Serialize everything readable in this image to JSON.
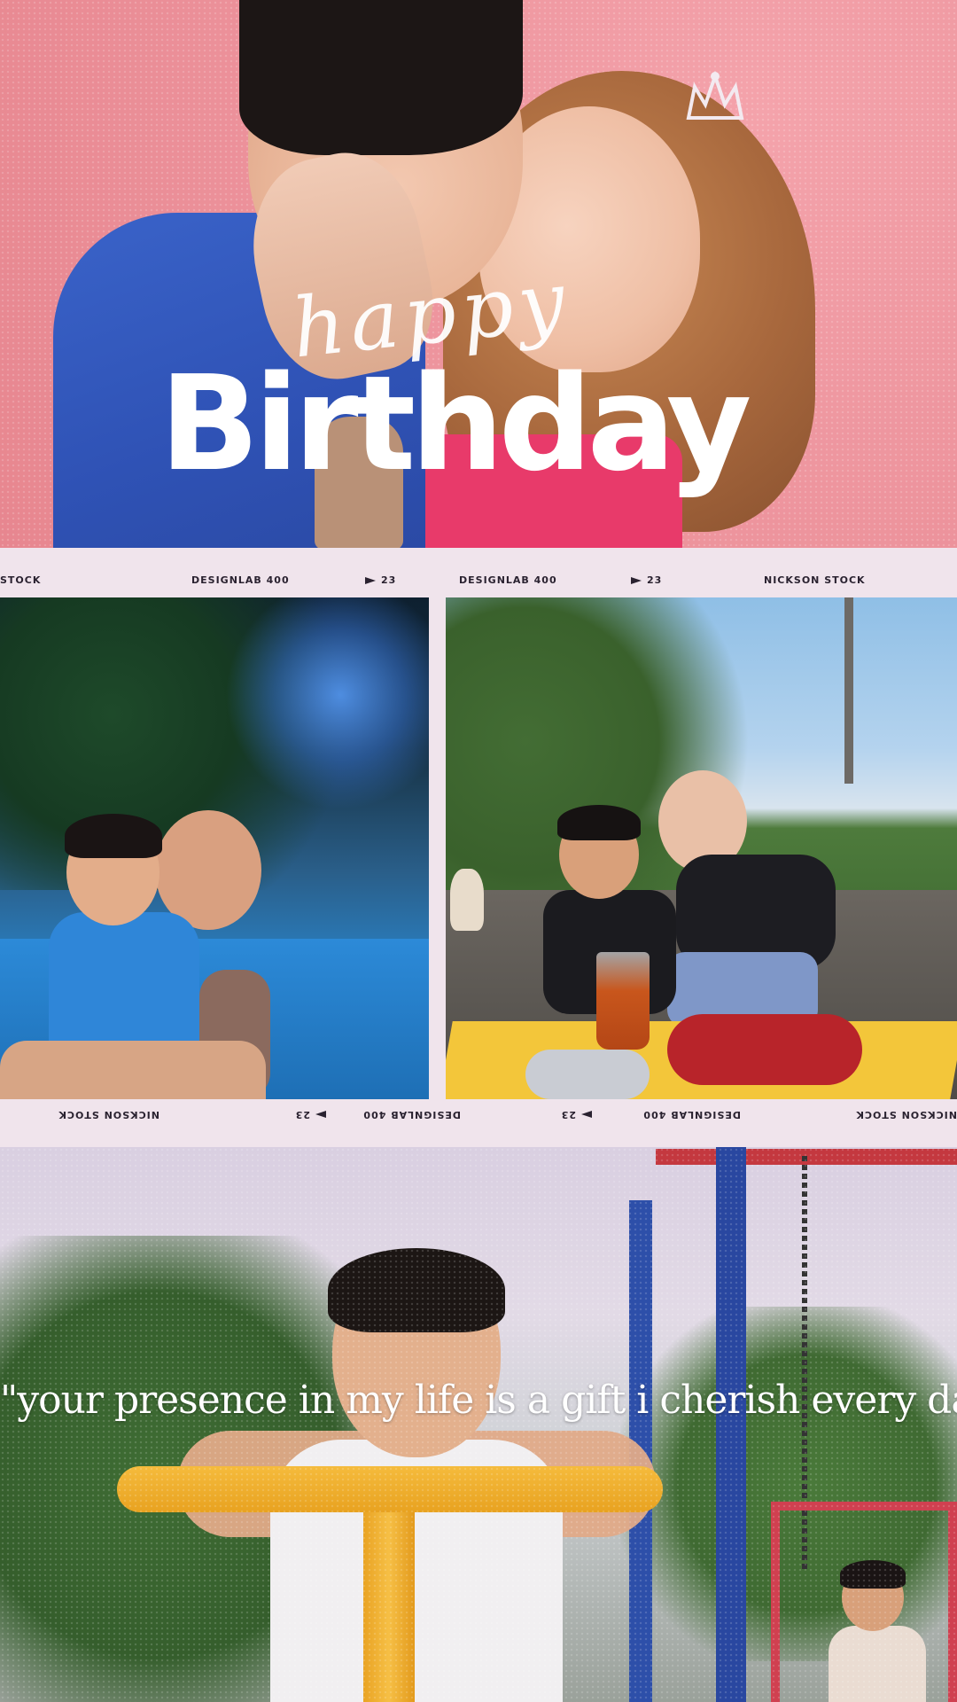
{
  "hero": {
    "script_word": "happy",
    "title": "Birthday"
  },
  "film_strip": {
    "top_labels": [
      "STOCK",
      "DESIGNLAB 400",
      "23",
      "DESIGNLAB 400",
      "23",
      "NICKSON STOCK"
    ],
    "bottom_labels": [
      "NICKSON STOCK",
      "23",
      "DESIGNLAB 400",
      "23",
      "DESIGNLAB 400",
      "NICKSON STOCK"
    ]
  },
  "quote": {
    "text": "\"your presence in my life is a gift i cherish every day\""
  },
  "colors": {
    "hero_background": "#ee969f",
    "film_background": "#f0e4ec",
    "text_white": "#ffffff",
    "film_text": "#2a2230"
  }
}
